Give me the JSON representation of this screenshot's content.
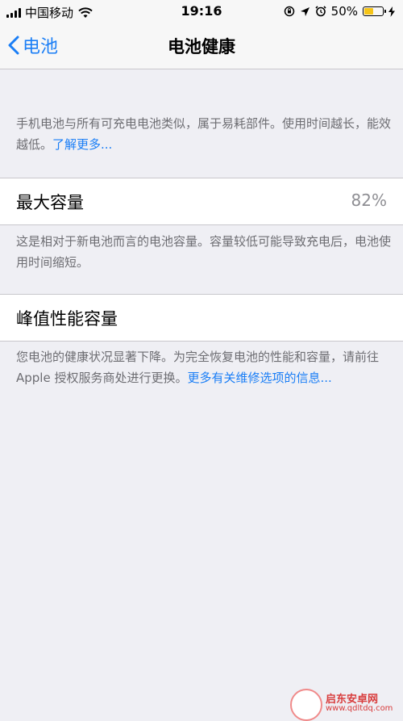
{
  "status_bar": {
    "carrier": "中国移动",
    "time": "19:16",
    "battery_percent": "50%",
    "battery_level": 0.5,
    "battery_color": "#f5c417",
    "icons": [
      "signal-icon",
      "wifi-icon",
      "orientation-lock-icon",
      "location-icon",
      "alarm-icon",
      "battery-icon",
      "charging-icon"
    ]
  },
  "nav": {
    "back_label": "电池",
    "title": "电池健康"
  },
  "intro": {
    "text": "手机电池与所有可充电电池类似，属于易耗部件。使用时间越长，能效越低。",
    "link": "了解更多..."
  },
  "max_capacity": {
    "label": "最大容量",
    "value": "82%",
    "description": "这是相对于新电池而言的电池容量。容量较低可能导致充电后，电池使用时间缩短。"
  },
  "peak_performance": {
    "label": "峰值性能容量",
    "description": "您电池的健康状况显著下降。为完全恢复电池的性能和容量，请前往 Apple 授权服务商处进行更换。",
    "link": "更多有关维修选项的信息..."
  },
  "watermark": {
    "name": "启东安卓网",
    "url": "www.qdltdq.com"
  },
  "colors": {
    "accent": "#1a7ef6",
    "background": "#efeff4",
    "footnote": "#6d6d72",
    "value": "#8e8e93"
  }
}
